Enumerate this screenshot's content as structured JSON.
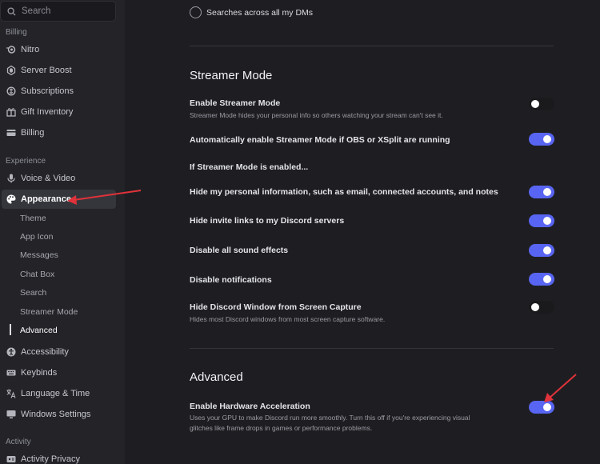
{
  "search": {
    "placeholder": "Search"
  },
  "sidebar": {
    "billing_header": "Billing",
    "billing_items": [
      {
        "label": "Nitro"
      },
      {
        "label": "Server Boost"
      },
      {
        "label": "Subscriptions"
      },
      {
        "label": "Gift Inventory"
      },
      {
        "label": "Billing"
      }
    ],
    "experience_header": "Experience",
    "voice_video": "Voice & Video",
    "appearance": "Appearance",
    "appearance_subitems": [
      "Theme",
      "App Icon",
      "Messages",
      "Chat Box",
      "Search",
      "Streamer Mode",
      "Advanced"
    ],
    "accessibility": "Accessibility",
    "keybinds": "Keybinds",
    "language_time": "Language & Time",
    "windows_settings": "Windows Settings",
    "activity_header": "Activity",
    "activity_privacy": "Activity Privacy"
  },
  "main": {
    "search_dms_option": "Searches across all my DMs",
    "streamer_mode": {
      "title": "Streamer Mode",
      "enable_label": "Enable Streamer Mode",
      "enable_desc": "Streamer Mode hides your personal info so others watching your stream can't see it.",
      "enable_on": false,
      "auto_label": "Automatically enable Streamer Mode if OBS or XSplit are running",
      "auto_on": true,
      "if_enabled_label": "If Streamer Mode is enabled...",
      "hide_info_label": "Hide my personal information, such as email, connected accounts, and notes",
      "hide_info_on": true,
      "hide_invites_label": "Hide invite links to my Discord servers",
      "hide_invites_on": true,
      "disable_sounds_label": "Disable all sound effects",
      "disable_sounds_on": true,
      "disable_notifs_label": "Disable notifications",
      "disable_notifs_on": true,
      "hide_window_label": "Hide Discord Window from Screen Capture",
      "hide_window_desc": "Hides most Discord windows from most screen capture software.",
      "hide_window_on": false
    },
    "advanced": {
      "title": "Advanced",
      "hw_accel_label": "Enable Hardware Acceleration",
      "hw_accel_desc": "Uses your GPU to make Discord run more smoothly. Turn this off if you're experiencing visual glitches like frame drops in games or performance problems.",
      "hw_accel_on": true
    }
  },
  "colors": {
    "accent": "#5865f2",
    "arrow": "#e0323a"
  }
}
